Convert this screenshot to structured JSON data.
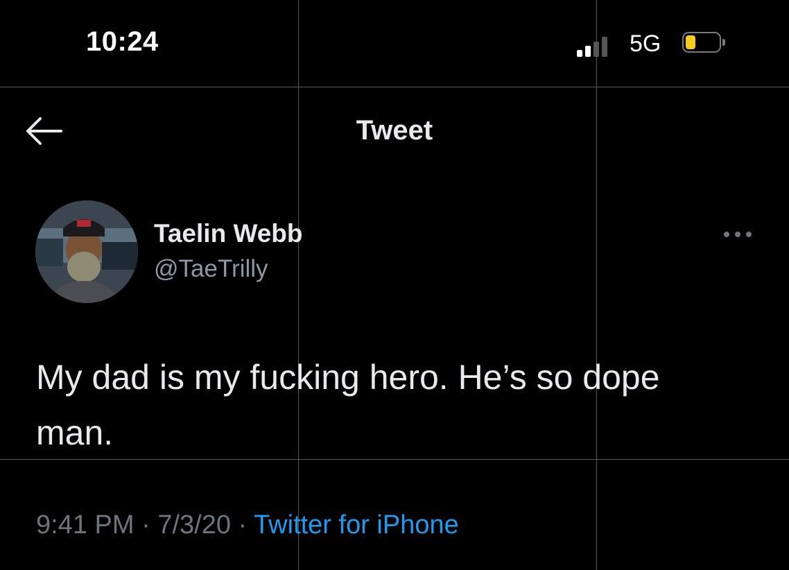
{
  "status_bar": {
    "time": "10:24",
    "network": "5G",
    "signal_bars_active": 2,
    "signal_bars_total": 4,
    "battery_level": 0.3,
    "battery_color": "#f5cc1c"
  },
  "header": {
    "title": "Tweet",
    "back_icon": "arrow-left-icon"
  },
  "tweet": {
    "author_name": "Taelin Webb",
    "author_handle": "@TaeTrilly",
    "more_icon": "more-horizontal-icon",
    "text": "My dad is my fucking hero. He’s so dope man.",
    "time": "9:41 PM",
    "separator": " · ",
    "date": "7/3/20",
    "source": "Twitter for iPhone"
  },
  "colors": {
    "background": "#000000",
    "primary_text": "#e7e9ea",
    "secondary_text": "#8b98a5",
    "accent": "#1d9bf0"
  }
}
